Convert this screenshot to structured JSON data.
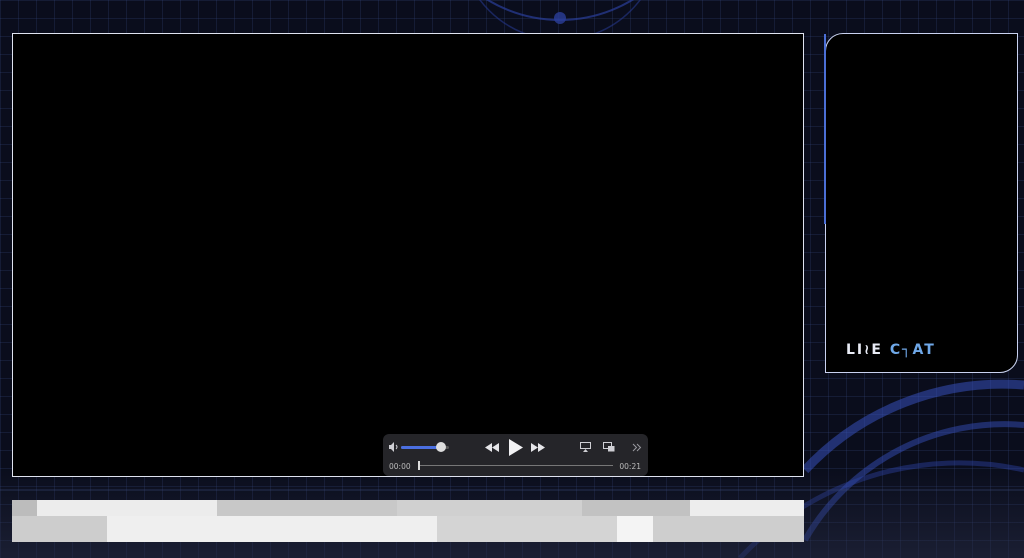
{
  "chat": {
    "logo_part1": "LI≀E",
    "logo_part2": "C┐AT"
  },
  "player": {
    "current_time": "00:00",
    "duration": "00:21",
    "volume_fraction": 0.83,
    "progress_fraction": 0.0
  },
  "colors": {
    "accent": "#4b6fe0",
    "logo_accent": "#6fa8e8"
  },
  "icons": [
    "volume-icon",
    "rewind-icon",
    "play-icon",
    "fast-forward-icon",
    "airplay-icon",
    "picture-in-picture-icon",
    "more-icon"
  ]
}
